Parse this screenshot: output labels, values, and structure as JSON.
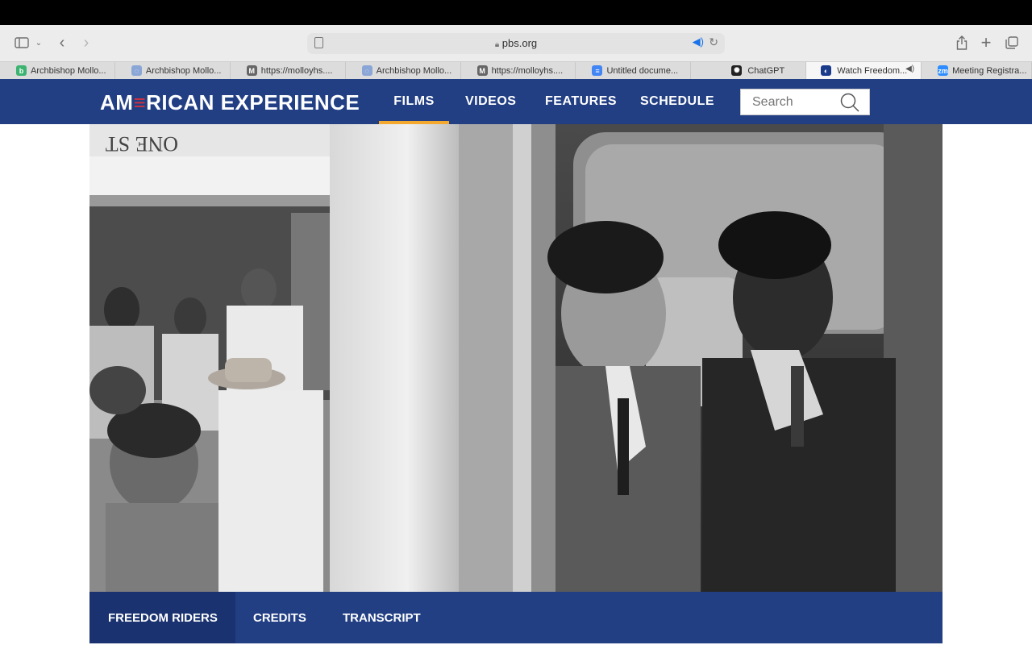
{
  "browser": {
    "address": "pbs.org",
    "tabs": [
      {
        "title": "Archbishop Mollo...",
        "fav_color": "#3cb371",
        "fav_glyph": "b"
      },
      {
        "title": "Archbishop Mollo...",
        "fav_color": "#8aa6d6",
        "fav_glyph": "◌"
      },
      {
        "title": "https://molloyhs....",
        "fav_color": "#666666",
        "fav_glyph": "M"
      },
      {
        "title": "Archbishop Mollo...",
        "fav_color": "#8aa6d6",
        "fav_glyph": "◌"
      },
      {
        "title": "https://molloyhs....",
        "fav_color": "#666666",
        "fav_glyph": "M"
      },
      {
        "title": "Untitled docume...",
        "fav_color": "#4285f4",
        "fav_glyph": "≡"
      },
      {
        "title": "ChatGPT",
        "fav_color": "#222222",
        "fav_glyph": "✺"
      },
      {
        "title": "Watch Freedom...",
        "fav_color": "#1a3a8a",
        "fav_glyph": "◐"
      },
      {
        "title": "Meeting Registra...",
        "fav_color": "#2d8cff",
        "fav_glyph": "zm"
      }
    ],
    "active_tab_index": 7,
    "icons": [
      "sidebar-icon",
      "chevron-down-icon",
      "back-icon",
      "forward-icon",
      "share-icon",
      "new-tab-icon",
      "tab-overview-icon",
      "reader-icon",
      "audio-icon",
      "reload-icon",
      "lock-icon"
    ]
  },
  "site": {
    "logo": {
      "pre": "AM",
      "flag": "≡",
      "post": "RICAN EXPERIENCE"
    },
    "nav": {
      "films": "FILMS",
      "videos": "VIDEOS",
      "features": "FEATURES",
      "schedule": "SCHEDULE"
    },
    "search_placeholder": "Search",
    "active_nav": "FILMS",
    "colors": {
      "nav_bg": "#223f84",
      "active_underline": "#f3a92f"
    }
  },
  "film_nav": {
    "freedom_riders": "FREEDOM RIDERS",
    "credits": "CREDITS",
    "transcript": "TRANSCRIPT"
  }
}
